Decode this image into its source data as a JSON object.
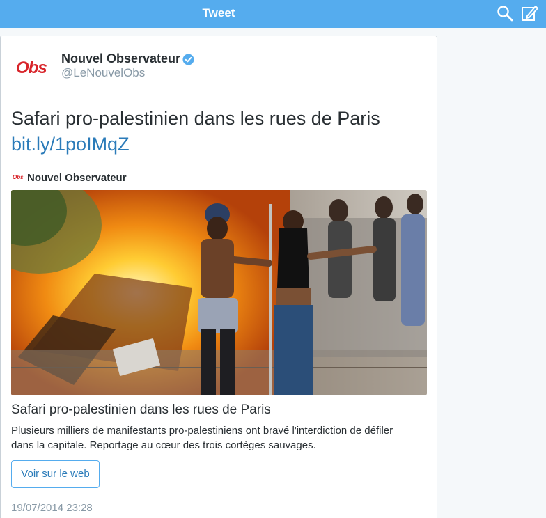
{
  "header": {
    "title": "Tweet",
    "search_icon": "search-icon",
    "compose_icon": "compose-tweet-icon",
    "background": "#55acee"
  },
  "tweet": {
    "author_name": "Nouvel Observateur",
    "author_handle": "@LeNouvelObs",
    "avatar_logo_text": "Obs",
    "verified_icon": "verified-badge-icon",
    "text": "Safari pro-palestinien dans les rues de Paris",
    "link": "bit.ly/1poIMqZ",
    "link_color": "#2b7bb9",
    "card": {
      "source_logo_text": "Obs",
      "source_name": "Nouvel Observateur",
      "image_icon": "news-photo-image",
      "title": "Safari pro-palestinien dans les rues de Paris",
      "description": "Plusieurs milliers de manifestants pro-palestiniens ont bravé l'interdiction de défiler dans la capitale. Reportage au cœur des trois cortèges sauvages.",
      "button_label": "Voir sur le web"
    },
    "timestamp": "19/07/2014 23:28"
  }
}
